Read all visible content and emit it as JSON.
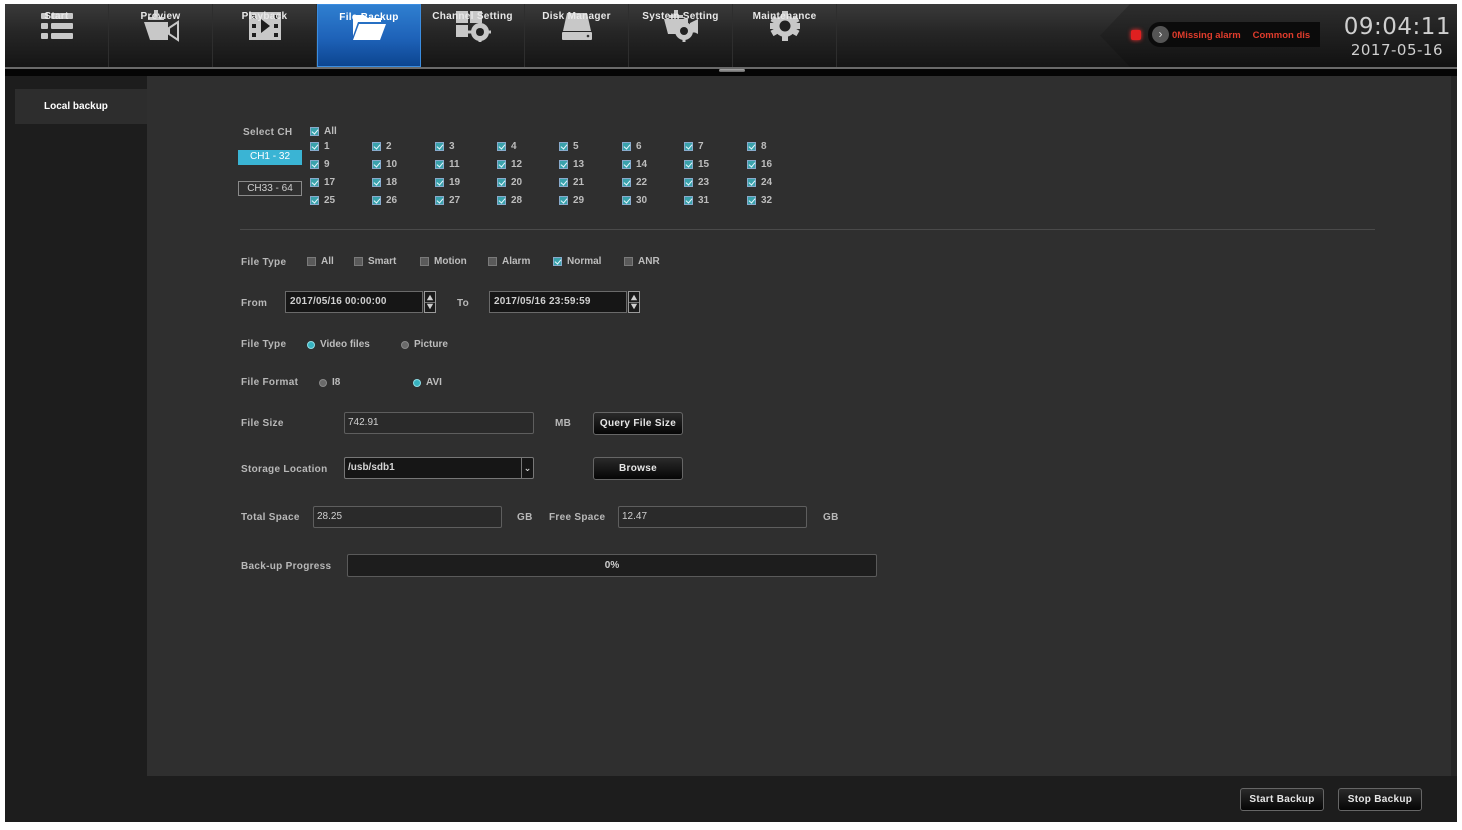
{
  "nav": {
    "items": [
      {
        "label": "Start",
        "icon": "list-icon",
        "active": false
      },
      {
        "label": "Preview",
        "icon": "camera-icon",
        "active": false
      },
      {
        "label": "Playback",
        "icon": "film-play-icon",
        "active": false
      },
      {
        "label": "File Backup",
        "icon": "folder-open-icon",
        "active": true
      },
      {
        "label": "Channel Setting",
        "icon": "grid-gear-icon",
        "active": false
      },
      {
        "label": "Disk Manager",
        "icon": "hard-disk-icon",
        "active": false
      },
      {
        "label": "System Setting",
        "icon": "camera-gear-icon",
        "active": false
      },
      {
        "label": "Maintenance",
        "icon": "gear-icon",
        "active": false
      }
    ]
  },
  "status": {
    "alarm_messages": [
      "0Missing alarm",
      "Common dis"
    ],
    "time": "09:04:11",
    "date": "2017-05-16",
    "colors": {
      "alarm_text": "#e03c2c",
      "active_tab": "#1e62b8",
      "accent": "#3ab4d4"
    }
  },
  "sidebar": {
    "items": [
      {
        "label": "Local backup",
        "active": true
      }
    ]
  },
  "channels": {
    "label": "Select CH",
    "all_label": "All",
    "all_checked": true,
    "ranges": [
      {
        "label": "CH1 - 32",
        "active": true
      },
      {
        "label": "CH33 - 64",
        "active": false
      }
    ],
    "items": [
      {
        "n": "1",
        "checked": true
      },
      {
        "n": "2",
        "checked": true
      },
      {
        "n": "3",
        "checked": true
      },
      {
        "n": "4",
        "checked": true
      },
      {
        "n": "5",
        "checked": true
      },
      {
        "n": "6",
        "checked": true
      },
      {
        "n": "7",
        "checked": true
      },
      {
        "n": "8",
        "checked": true
      },
      {
        "n": "9",
        "checked": true
      },
      {
        "n": "10",
        "checked": true
      },
      {
        "n": "11",
        "checked": true
      },
      {
        "n": "12",
        "checked": true
      },
      {
        "n": "13",
        "checked": true
      },
      {
        "n": "14",
        "checked": true
      },
      {
        "n": "15",
        "checked": true
      },
      {
        "n": "16",
        "checked": true
      },
      {
        "n": "17",
        "checked": true
      },
      {
        "n": "18",
        "checked": true
      },
      {
        "n": "19",
        "checked": true
      },
      {
        "n": "20",
        "checked": true
      },
      {
        "n": "21",
        "checked": true
      },
      {
        "n": "22",
        "checked": true
      },
      {
        "n": "23",
        "checked": true
      },
      {
        "n": "24",
        "checked": true
      },
      {
        "n": "25",
        "checked": true
      },
      {
        "n": "26",
        "checked": true
      },
      {
        "n": "27",
        "checked": true
      },
      {
        "n": "28",
        "checked": true
      },
      {
        "n": "29",
        "checked": true
      },
      {
        "n": "30",
        "checked": true
      },
      {
        "n": "31",
        "checked": true
      },
      {
        "n": "32",
        "checked": true
      }
    ]
  },
  "file_type_events": {
    "label": "File Type",
    "options": [
      {
        "label": "All",
        "checked": false
      },
      {
        "label": "Smart",
        "checked": false
      },
      {
        "label": "Motion",
        "checked": false
      },
      {
        "label": "Alarm",
        "checked": false
      },
      {
        "label": "Normal",
        "checked": true
      },
      {
        "label": "ANR",
        "checked": false
      }
    ]
  },
  "time_range": {
    "from_label": "From",
    "from_value": "2017/05/16 00:00:00",
    "to_label": "To",
    "to_value": "2017/05/16 23:59:59"
  },
  "file_type_media": {
    "label": "File Type",
    "options": [
      {
        "label": "Video files",
        "selected": true
      },
      {
        "label": "Picture",
        "selected": false
      }
    ]
  },
  "file_format": {
    "label": "File Format",
    "options": [
      {
        "label": "I8",
        "selected": false
      },
      {
        "label": "AVI",
        "selected": true
      }
    ]
  },
  "file_size": {
    "label": "File Size",
    "value": "742.91",
    "unit": "MB",
    "query_button": "Query File Size"
  },
  "storage": {
    "label": "Storage Location",
    "value": "/usb/sdb1",
    "browse_button": "Browse"
  },
  "space": {
    "total_label": "Total Space",
    "total_value": "28.25",
    "total_unit": "GB",
    "free_label": "Free Space",
    "free_value": "12.47",
    "free_unit": "GB"
  },
  "progress": {
    "label": "Back-up Progress",
    "percent": 0,
    "text": "0%"
  },
  "actions": {
    "start": "Start Backup",
    "stop": "Stop Backup"
  }
}
